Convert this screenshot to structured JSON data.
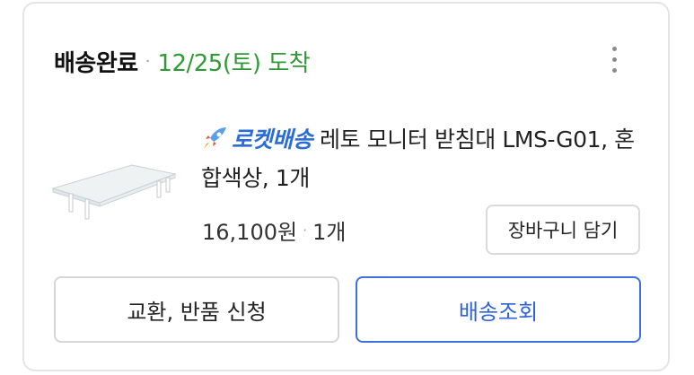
{
  "order": {
    "status": "배송완료",
    "separator": "·",
    "arrival": "12/25(토) 도착"
  },
  "product": {
    "badge": "로켓배송",
    "badge_icon": "rocket-icon",
    "title": "레토 모니터 받침대 LMS-G01, 혼합색상, 1개",
    "price": "16,100원",
    "price_separator": "·",
    "quantity": "1개"
  },
  "actions": {
    "add_to_cart": "장바구니 담기",
    "return_request": "교환, 반품 신청",
    "track_delivery": "배송조회"
  },
  "colors": {
    "status_green": "#2f9a37",
    "brand_blue": "#2f63d6"
  }
}
